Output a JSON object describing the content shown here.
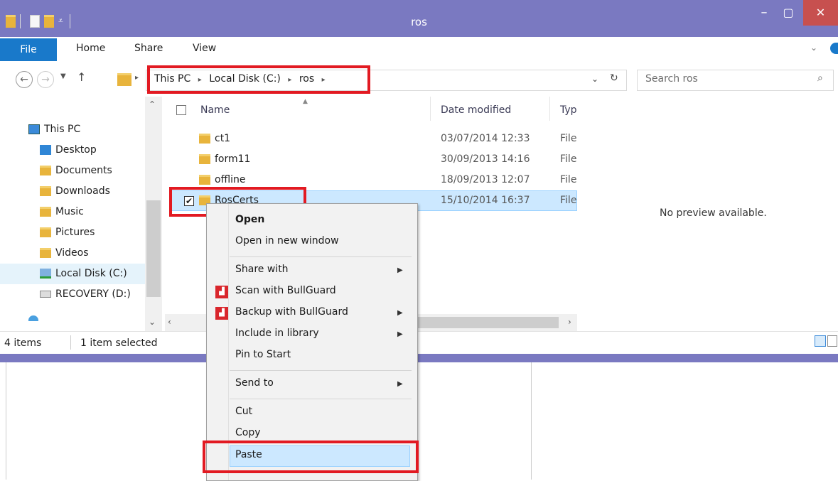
{
  "window": {
    "title": "ros"
  },
  "colors": {
    "titlebar": "#7a79c1",
    "file_tab": "#1979ca",
    "highlight": "#cce8ff",
    "red_outline": "#e21a22"
  },
  "ribbon": {
    "tabs": [
      "File",
      "Home",
      "Share",
      "View"
    ]
  },
  "address": {
    "crumbs": [
      "This PC",
      "Local Disk (C:)",
      "ros"
    ],
    "separator": "▸",
    "search_placeholder": "Search ros"
  },
  "nav": {
    "items": [
      "This PC",
      "Desktop",
      "Documents",
      "Downloads",
      "Music",
      "Pictures",
      "Videos",
      "Local Disk (C:)",
      "RECOVERY (D:)"
    ]
  },
  "files": {
    "columns": {
      "name": "Name",
      "date": "Date modified",
      "type": "Typ"
    },
    "rows": [
      {
        "name": "ct1",
        "date": "03/07/2014 12:33",
        "type": "File"
      },
      {
        "name": "form11",
        "date": "30/09/2013 14:16",
        "type": "File"
      },
      {
        "name": "offline",
        "date": "18/09/2013 12:07",
        "type": "File"
      },
      {
        "name": "RosCerts",
        "date": "15/10/2014 16:37",
        "type": "File"
      }
    ]
  },
  "preview": {
    "text": "No preview available."
  },
  "status": {
    "count": "4 items",
    "selected": "1 item selected"
  },
  "context_menu": {
    "open": "Open",
    "open_new_window": "Open in new window",
    "share_with": "Share with",
    "scan": "Scan with BullGuard",
    "backup": "Backup with BullGuard",
    "include": "Include in library",
    "pin": "Pin to Start",
    "send_to": "Send to",
    "cut": "Cut",
    "copy": "Copy",
    "paste": "Paste"
  }
}
